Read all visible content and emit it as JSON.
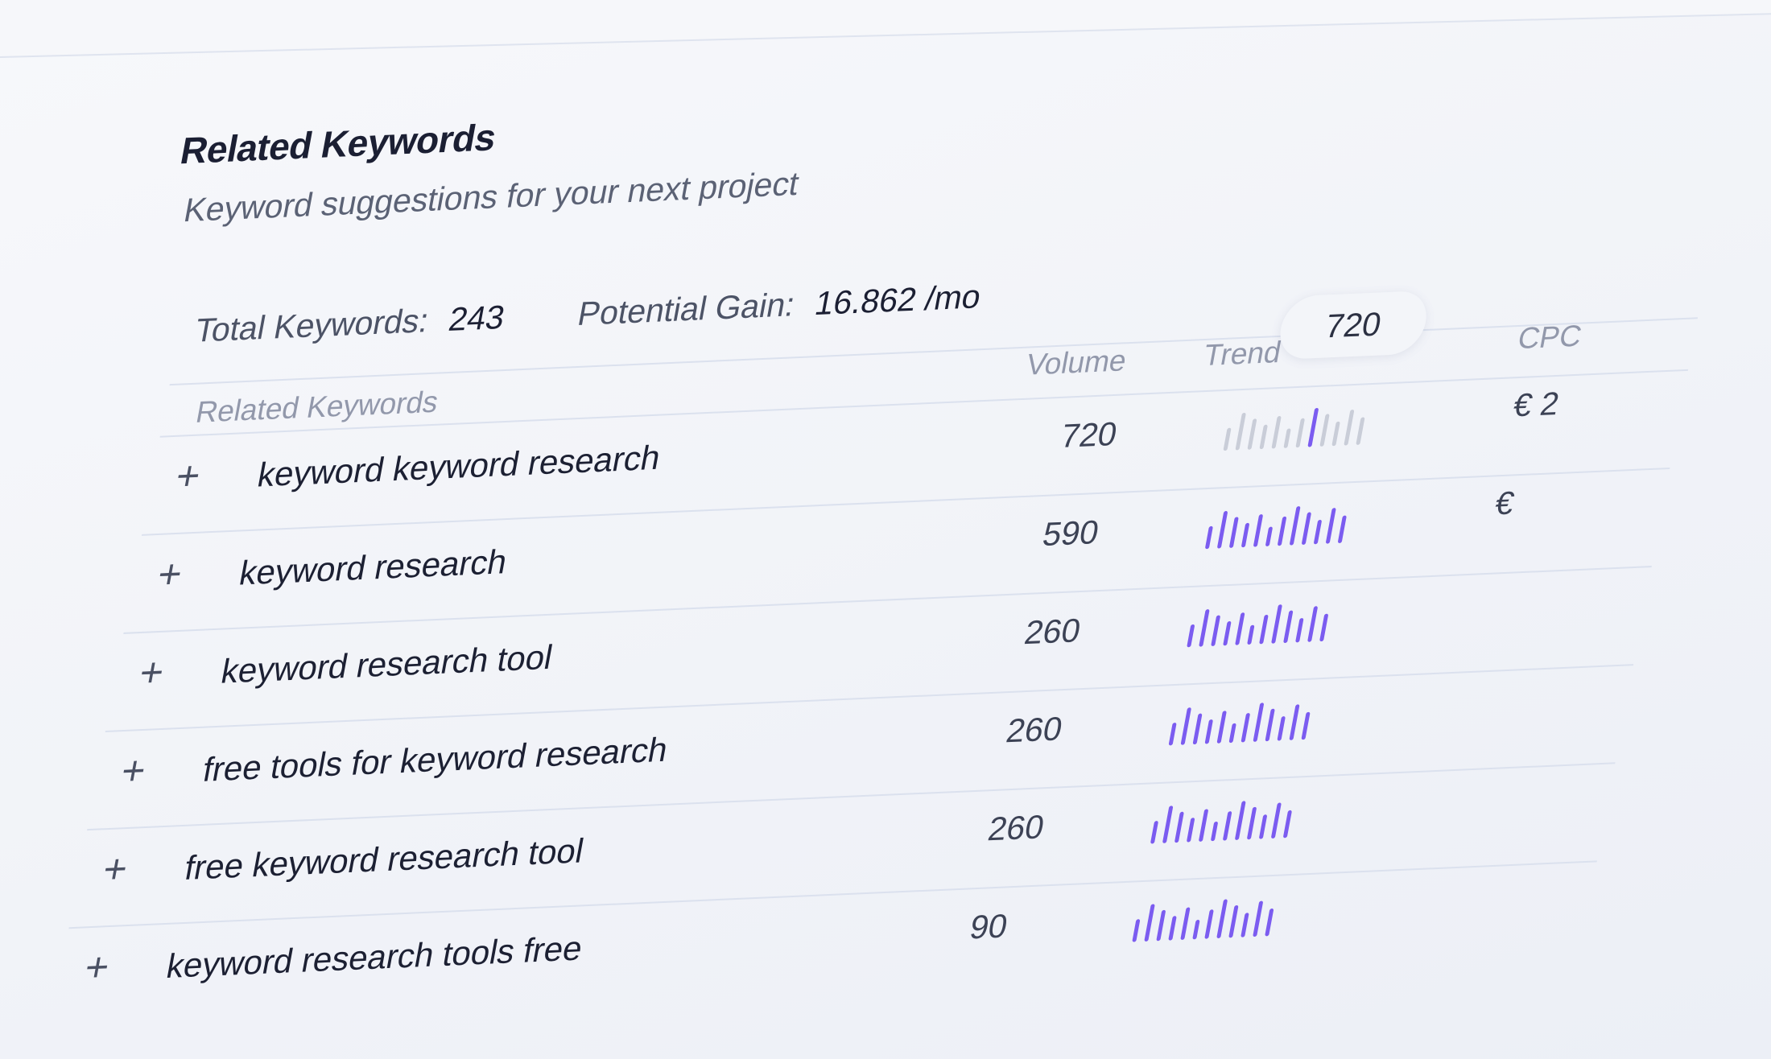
{
  "header": {
    "title": "Related Keywords",
    "subtitle": "Keyword suggestions for your next project"
  },
  "stats": {
    "total_label": "Total Keywords:",
    "total_value": "243",
    "gain_label": "Potential Gain:",
    "gain_value": "16.862 /mo"
  },
  "table": {
    "columns": {
      "keyword": "Related Keywords",
      "volume": "Volume",
      "trend": "Trend",
      "cpc": "CPC"
    },
    "tooltip_value": "720",
    "rows": [
      {
        "keyword": "keyword keyword research",
        "volume": "720",
        "cpc": "€ 2",
        "highlighted": true
      },
      {
        "keyword": "keyword research",
        "volume": "590",
        "cpc": "€"
      },
      {
        "keyword": "keyword research tool",
        "volume": "260",
        "cpc": ""
      },
      {
        "keyword": "free tools for keyword research",
        "volume": "260",
        "cpc": ""
      },
      {
        "keyword": "free keyword research tool",
        "volume": "260",
        "cpc": ""
      },
      {
        "keyword": "keyword research tools free",
        "volume": "90",
        "cpc": ""
      }
    ],
    "add_icon": "plus-icon"
  },
  "colors": {
    "accent": "#7b5cf0",
    "muted_bar": "#c9cdd8",
    "text_dark": "#1c2033",
    "text_muted": "#9298ab"
  }
}
